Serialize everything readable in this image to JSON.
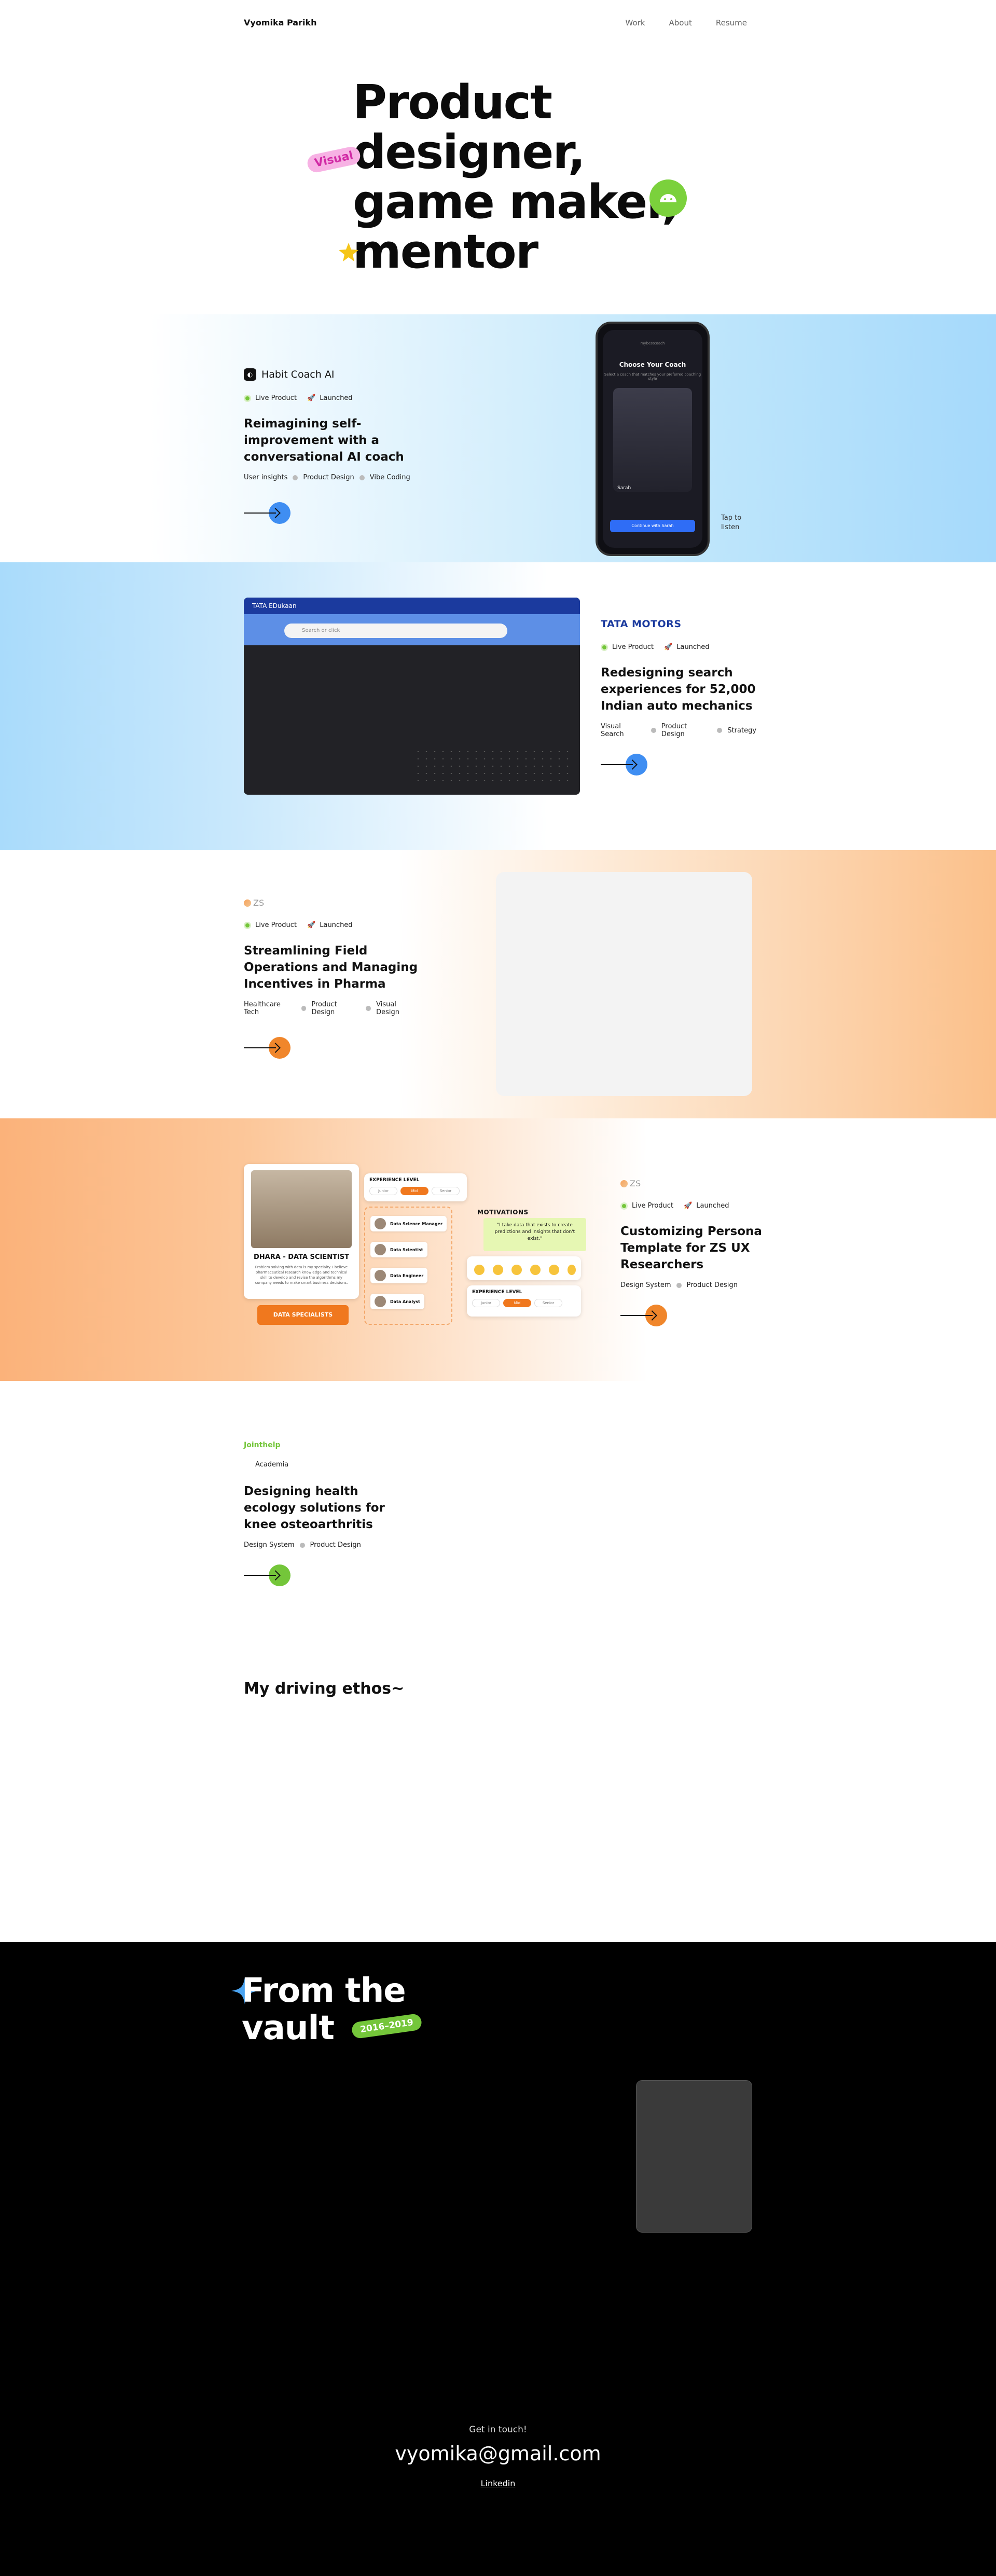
{
  "nav": {
    "brand": "Vyomika Parikh",
    "links": [
      "Work",
      "About",
      "Resume"
    ]
  },
  "hero": {
    "lines": [
      "Product",
      "designer,",
      "game maker,",
      "mentor"
    ],
    "sticker": "Visual"
  },
  "projects": [
    {
      "company": "Habit Coach AI",
      "status": [
        "Live Product",
        "Launched"
      ],
      "title": "Reimagining self-improvement with a conversational AI coach",
      "tags": [
        "User insights",
        "Product Design",
        "Vibe Coding"
      ],
      "accent": "#3f8ef2",
      "mock": {
        "app_header": "mybestcoach",
        "screen_title": "Choose Your Coach",
        "screen_sub": "Select a coach that matches your preferred coaching style",
        "coach_name": "Sarah",
        "cta": "Continue with Sarah",
        "note": [
          "Tap to",
          "listen"
        ]
      }
    },
    {
      "company": "TATA MOTORS",
      "status": [
        "Live Product",
        "Launched"
      ],
      "title": "Redesigning search experiences for 52,000 Indian auto mechanics",
      "tags": [
        "Visual Search",
        "Product Design",
        "Strategy"
      ],
      "accent": "#3f8ef2",
      "mock": {
        "brand": "TATA EDukaan",
        "search_placeholder": "Search or click"
      }
    },
    {
      "company": "ZS",
      "status": [
        "Live Product",
        "Launched"
      ],
      "title": "Streamlining Field Operations and Managing Incentives in Pharma",
      "tags": [
        "Healthcare Tech",
        "Product Design",
        "Visual Design"
      ],
      "accent": "#f0862b"
    },
    {
      "company": "ZS",
      "status": [
        "Live Product",
        "Launched"
      ],
      "title": "Customizing Persona Template for ZS UX Researchers",
      "tags": [
        "Design System",
        "Product Design"
      ],
      "accent": "#f0862b",
      "mock": {
        "persona_name": "DHARA - DATA SCIENTIST",
        "persona_desc": "Problem solving with data is my specialty. I believe pharmaceutical research knowledge and technical skill to develop and revise the algorithms my company needs to make smart business decisions.",
        "badge": "DATA SPECIALISTS",
        "exp_title": "EXPERIENCE LEVEL",
        "exp_options": [
          "Junior",
          "Mid",
          "Senior"
        ],
        "roles": [
          "Data Science Manager",
          "Data Scientist",
          "Data Engineer",
          "Data Analyst"
        ],
        "motivations_title": "MOTIVATIONS",
        "quote": "\"I take data that exists to create predictions and insights that don't exist.\""
      }
    },
    {
      "company": "Jointhelp",
      "status": [
        "Academia"
      ],
      "title": "Designing health ecology solutions for knee osteoarthritis",
      "tags": [
        "Design System",
        "Product Design"
      ],
      "accent": "#74c63a"
    }
  ],
  "ethos": {
    "title": "My driving ethos~"
  },
  "vault": {
    "title_line1": "From the",
    "title_line2": "vault",
    "years": "2016–2019"
  },
  "contact": {
    "label": "Get in touch!",
    "email": "vyomika@gmail.com",
    "link": "Linkedin"
  }
}
